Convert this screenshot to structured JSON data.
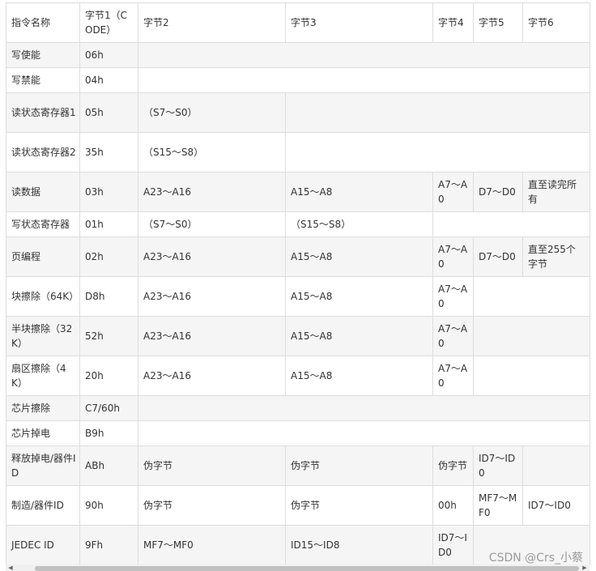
{
  "header": [
    "指令名称",
    "字节1（CODE）",
    "字节2",
    "字节3",
    "字节4",
    "字节5",
    "字节6"
  ],
  "rows": [
    {
      "cells": [
        [
          "写使能",
          1
        ],
        [
          "06h",
          1
        ],
        [
          "",
          5
        ]
      ]
    },
    {
      "cells": [
        [
          "写禁能",
          1
        ],
        [
          "04h",
          1
        ],
        [
          "",
          5
        ]
      ]
    },
    {
      "cells": [
        [
          "读状态寄存器1",
          1
        ],
        [
          "05h",
          1
        ],
        [
          "（S7～S0）",
          1
        ],
        [
          "",
          4
        ]
      ]
    },
    {
      "cells": [
        [
          "读状态寄存器2",
          1
        ],
        [
          "35h",
          1
        ],
        [
          "（S15～S8）",
          1
        ],
        [
          "",
          4
        ]
      ]
    },
    {
      "cells": [
        [
          "读数据",
          1
        ],
        [
          "03h",
          1
        ],
        [
          "A23～A16",
          1
        ],
        [
          "A15～A8",
          1
        ],
        [
          "A7～A0",
          1
        ],
        [
          "D7～D0",
          1
        ],
        [
          "直至读完所有",
          1
        ]
      ]
    },
    {
      "cells": [
        [
          "写状态寄存器",
          1
        ],
        [
          "01h",
          1
        ],
        [
          "（S7～S0）",
          1
        ],
        [
          "（S15～S8）",
          1
        ],
        [
          "",
          3
        ]
      ]
    },
    {
      "cells": [
        [
          "页编程",
          1
        ],
        [
          "02h",
          1
        ],
        [
          "A23～A16",
          1
        ],
        [
          "A15～A8",
          1
        ],
        [
          "A7～A0",
          1
        ],
        [
          "D7～D0",
          1
        ],
        [
          "直至255个字节",
          1
        ]
      ]
    },
    {
      "cells": [
        [
          "块擦除（64K）",
          1
        ],
        [
          "D8h",
          1
        ],
        [
          "A23～A16",
          1
        ],
        [
          "A15～A8",
          1
        ],
        [
          "A7～A0",
          1
        ],
        [
          "",
          2
        ]
      ]
    },
    {
      "cells": [
        [
          "半块擦除（32K）",
          1
        ],
        [
          "52h",
          1
        ],
        [
          "A23～A16",
          1
        ],
        [
          "A15～A8",
          1
        ],
        [
          "A7～A0",
          1
        ],
        [
          "",
          2
        ]
      ]
    },
    {
      "cells": [
        [
          "扇区擦除（4K）",
          1
        ],
        [
          "20h",
          1
        ],
        [
          "A23～A16",
          1
        ],
        [
          "A15～A8",
          1
        ],
        [
          "A7～A0",
          1
        ],
        [
          "",
          2
        ]
      ]
    },
    {
      "cells": [
        [
          "芯片擦除",
          1
        ],
        [
          "C7/60h",
          1
        ],
        [
          "",
          5
        ]
      ]
    },
    {
      "cells": [
        [
          "芯片掉电",
          1
        ],
        [
          "B9h",
          1
        ],
        [
          "",
          5
        ]
      ]
    },
    {
      "cells": [
        [
          "释放掉电/器件ID",
          1
        ],
        [
          "ABh",
          1
        ],
        [
          "伪字节",
          1
        ],
        [
          "伪字节",
          1
        ],
        [
          "伪字节",
          1
        ],
        [
          "ID7～ID0",
          1
        ],
        [
          "",
          1
        ]
      ]
    },
    {
      "cells": [
        [
          "制造/器件ID",
          1
        ],
        [
          "90h",
          1
        ],
        [
          "伪字节",
          1
        ],
        [
          "伪字节",
          1
        ],
        [
          "00h",
          1
        ],
        [
          "MF7～MF0",
          1
        ],
        [
          "ID7～ID0",
          1
        ]
      ]
    },
    {
      "cells": [
        [
          "JEDEC ID",
          1
        ],
        [
          "9Fh",
          1
        ],
        [
          "MF7～MF0",
          1
        ],
        [
          "ID15～ID8",
          1
        ],
        [
          "ID7～ID0",
          1
        ],
        [
          "",
          2
        ]
      ]
    }
  ],
  "watermark": "CSDN @Crs_小蔡"
}
